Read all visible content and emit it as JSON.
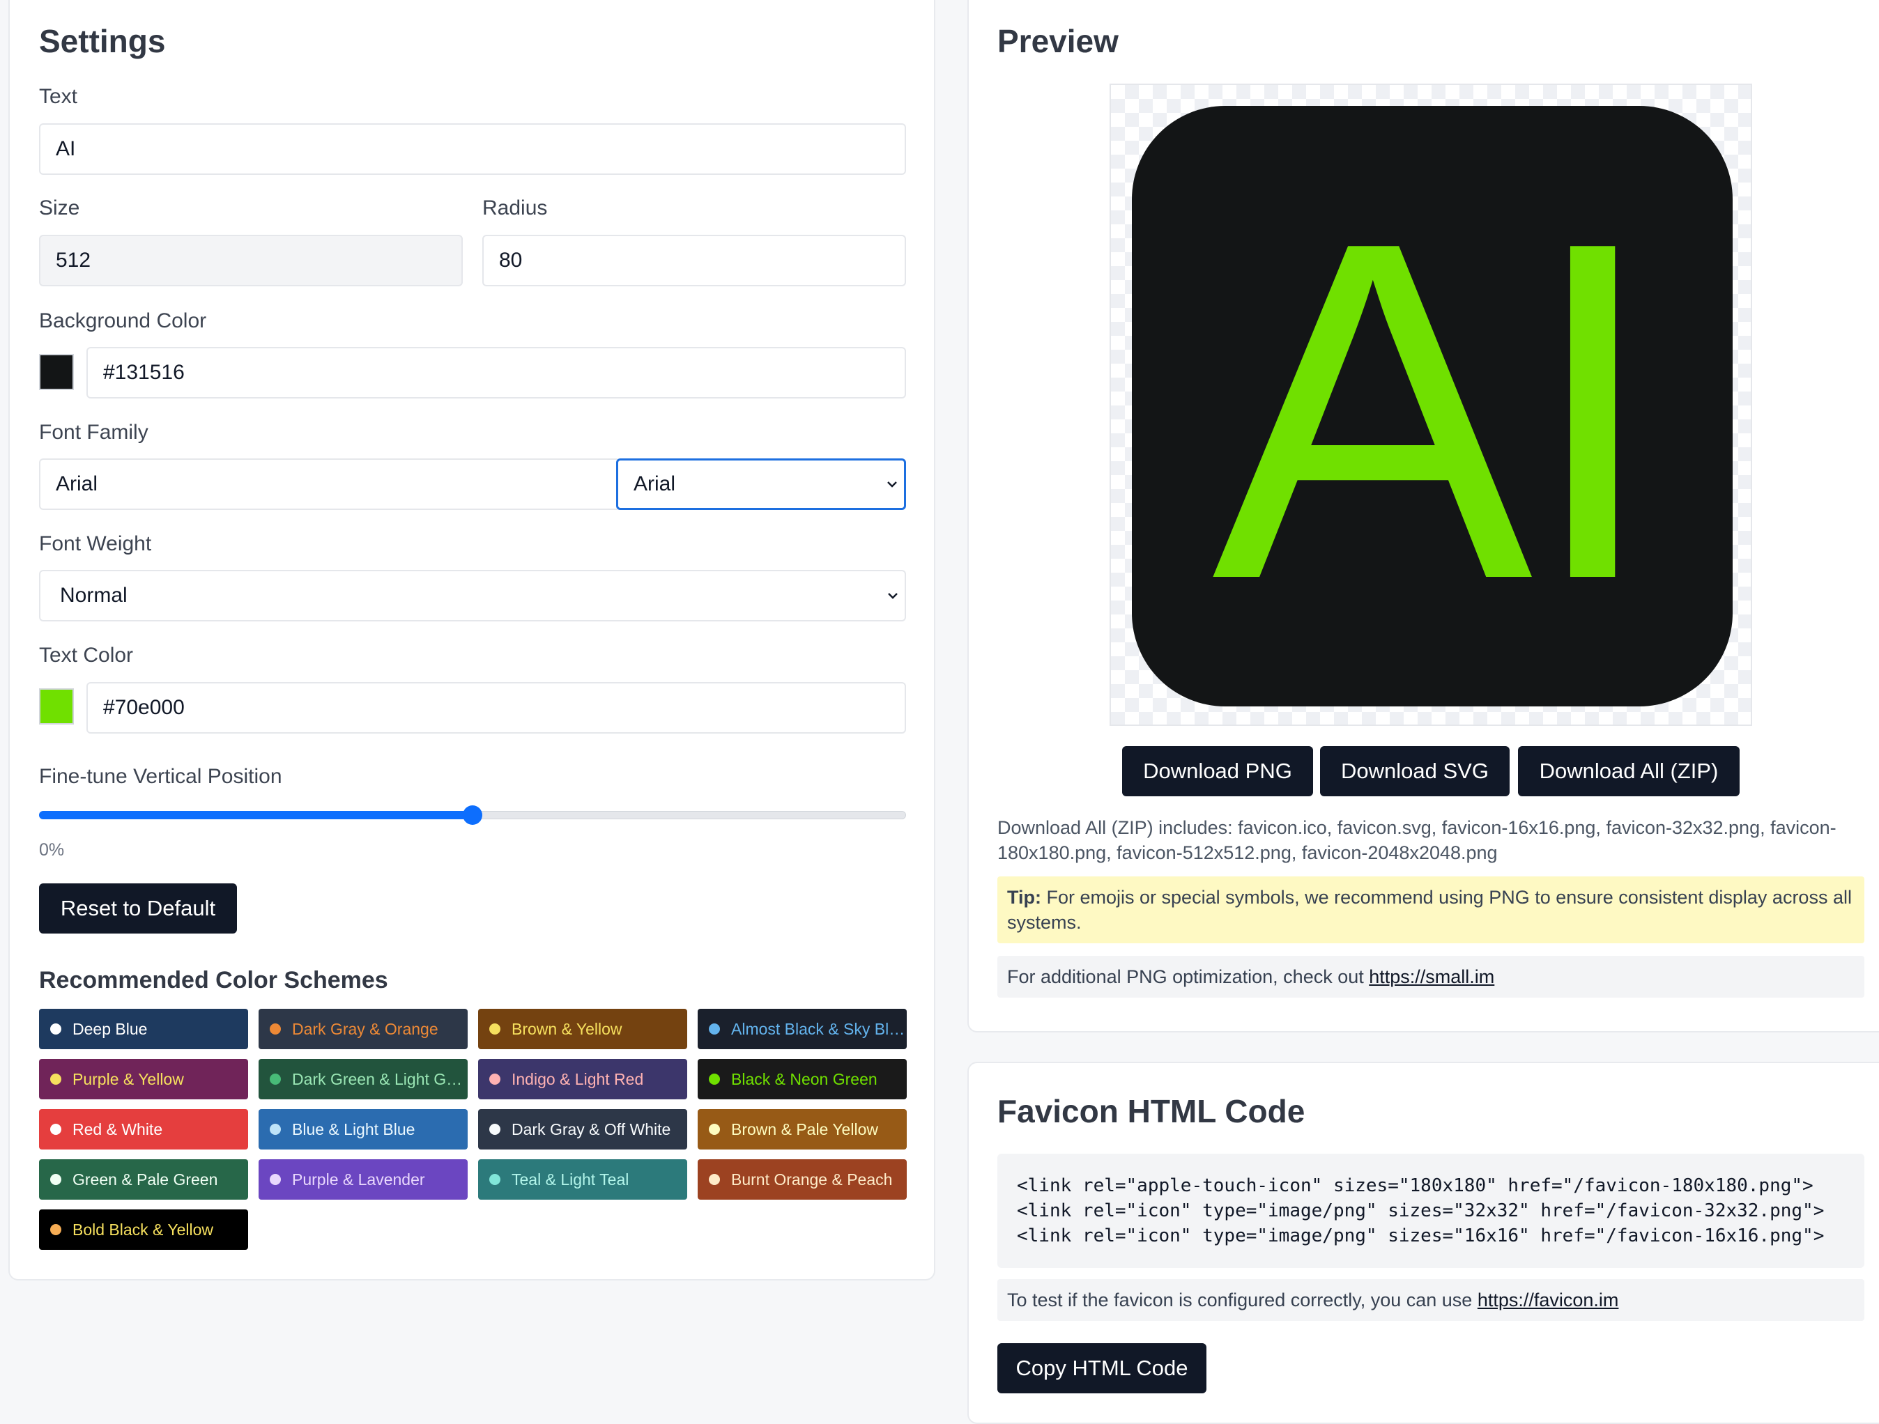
{
  "settings": {
    "title": "Settings",
    "text_label": "Text",
    "text_value": "AI",
    "size_label": "Size",
    "size_value": "512",
    "radius_label": "Radius",
    "radius_value": "80",
    "bg_label": "Background Color",
    "bg_value": "#131516",
    "font_family_label": "Font Family",
    "font_family_value": "Arial",
    "font_family_select": "Arial",
    "font_weight_label": "Font Weight",
    "font_weight_value": "Normal",
    "text_color_label": "Text Color",
    "text_color_value": "#70e000",
    "vertical_label": "Fine-tune Vertical Position",
    "vertical_value_text": "0%",
    "vertical_slider_fraction": 0.5,
    "reset_label": "Reset to Default",
    "schemes_title": "Recommended Color Schemes",
    "schemes": [
      {
        "name": "Deep Blue",
        "bg": "#1e3a5f",
        "fg": "#ffffff",
        "dot": "#ffffff"
      },
      {
        "name": "Dark Gray & Orange",
        "bg": "#2d3748",
        "fg": "#ed8936",
        "dot": "#ed8936"
      },
      {
        "name": "Brown & Yellow",
        "bg": "#744210",
        "fg": "#f6e05e",
        "dot": "#f6e05e"
      },
      {
        "name": "Almost Black & Sky Blue",
        "bg": "#1a202c",
        "fg": "#63b3ed",
        "dot": "#63b3ed"
      },
      {
        "name": "Purple & Yellow",
        "bg": "#702459",
        "fg": "#f6e05e",
        "dot": "#f6e05e"
      },
      {
        "name": "Dark Green & Light Green",
        "bg": "#22543d",
        "fg": "#9ae6b4",
        "dot": "#48bb78"
      },
      {
        "name": "Indigo & Light Red",
        "bg": "#3c366b",
        "fg": "#feb2b2",
        "dot": "#feb2b2"
      },
      {
        "name": "Black & Neon Green",
        "bg": "#1a1a1a",
        "fg": "#70e000",
        "dot": "#70e000"
      },
      {
        "name": "Red & White",
        "bg": "#e53e3e",
        "fg": "#ffffff",
        "dot": "#ffffff"
      },
      {
        "name": "Blue & Light Blue",
        "bg": "#2b6cb0",
        "fg": "#ebf8ff",
        "dot": "#bee3f8"
      },
      {
        "name": "Dark Gray & Off White",
        "bg": "#2d3748",
        "fg": "#f7fafc",
        "dot": "#f7fafc"
      },
      {
        "name": "Brown & Pale Yellow",
        "bg": "#975a16",
        "fg": "#fefcbf",
        "dot": "#fefcbf"
      },
      {
        "name": "Green & Pale Green",
        "bg": "#276749",
        "fg": "#f0fff4",
        "dot": "#f0fff4"
      },
      {
        "name": "Purple & Lavender",
        "bg": "#6b46c1",
        "fg": "#e9d8fd",
        "dot": "#e9d8fd"
      },
      {
        "name": "Teal & Light Teal",
        "bg": "#2c7a7b",
        "fg": "#b2f5ea",
        "dot": "#81e6d9"
      },
      {
        "name": "Burnt Orange & Peach",
        "bg": "#9c4221",
        "fg": "#feebc8",
        "dot": "#feebc8"
      },
      {
        "name": "Bold Black & Yellow",
        "bg": "#000000",
        "fg": "#f6e05e",
        "dot": "#f6ad55"
      }
    ]
  },
  "preview": {
    "title": "Preview",
    "icon_text": "AI",
    "icon_bg": "#131516",
    "icon_fg": "#70e000",
    "download_png": "Download PNG",
    "download_svg": "Download SVG",
    "download_zip": "Download All (ZIP)",
    "zip_note": "Download All (ZIP) includes: favicon.ico, favicon.svg, favicon-16x16.png, favicon-32x32.png, favicon-180x180.png, favicon-512x512.png, favicon-2048x2048.png",
    "tip_label": "Tip:",
    "tip_text": " For emojis or special symbols, we recommend using PNG to ensure consistent display across all systems.",
    "optimize_text": "For additional PNG optimization, check out ",
    "optimize_link": "https://small.im"
  },
  "html_code": {
    "title": "Favicon HTML Code",
    "code": "<link rel=\"apple-touch-icon\" sizes=\"180x180\" href=\"/favicon-180x180.png\">\n<link rel=\"icon\" type=\"image/png\" sizes=\"32x32\" href=\"/favicon-32x32.png\">\n<link rel=\"icon\" type=\"image/png\" sizes=\"16x16\" href=\"/favicon-16x16.png\">",
    "test_text": "To test if the favicon is configured correctly, you can use ",
    "test_link": "https://favicon.im",
    "copy_label": "Copy HTML Code"
  },
  "colors": {
    "accent": "#0d6efd",
    "dark_button": "#111827",
    "tip_bg": "#fef9c3"
  }
}
